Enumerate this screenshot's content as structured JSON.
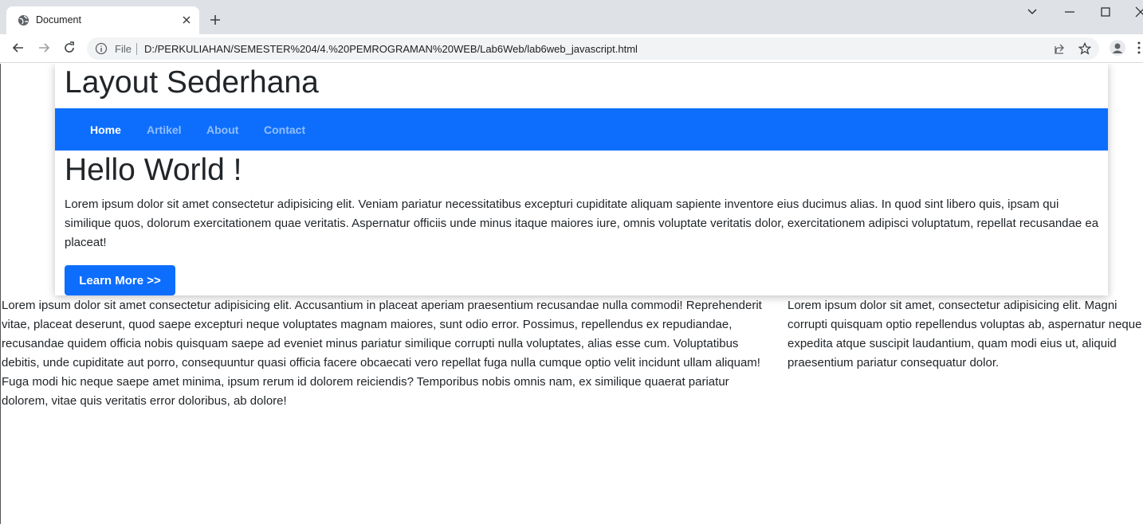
{
  "browser": {
    "tab_title": "Document",
    "file_label": "File",
    "url": "D:/PERKULIAHAN/SEMESTER%204/4.%20PEMROGRAMAN%20WEB/Lab6Web/lab6web_javascript.html",
    "icons": [
      "globe-icon",
      "close-icon",
      "plus-icon",
      "chevron-down-icon",
      "minimize-icon",
      "maximize-icon",
      "back-icon",
      "forward-icon",
      "reload-icon",
      "info-icon",
      "share-icon",
      "star-icon",
      "profile-icon",
      "menu-icon"
    ]
  },
  "page": {
    "site_title": "Layout Sederhana",
    "nav": [
      {
        "label": "Home"
      },
      {
        "label": "Artikel"
      },
      {
        "label": "About"
      },
      {
        "label": "Contact"
      }
    ],
    "hero": {
      "title": "Hello World !",
      "text": "Lorem ipsum dolor sit amet consectetur adipisicing elit. Veniam pariatur necessitatibus excepturi cupiditate aliquam sapiente inventore eius ducimus alias. In quod sint libero quis, ipsam qui similique quos, dolorum exercitationem quae veritatis. Aspernatur officiis unde minus itaque maiores iure, omnis voluptate veritatis dolor, exercitationem adipisci voluptatum, repellat recusandae ea placeat!",
      "button": "Learn More >>"
    },
    "main_article": "Lorem ipsum dolor sit amet consectetur adipisicing elit. Accusantium in placeat aperiam praesentium recusandae nulla commodi! Reprehenderit vitae, placeat deserunt, quod saepe excepturi neque voluptates magnam maiores, sunt odio error. Possimus, repellendus ex repudiandae, recusandae quidem officia nobis quisquam saepe ad eveniet minus pariatur similique corrupti nulla voluptates, alias esse cum. Voluptatibus debitis, unde cupiditate aut porro, consequuntur quasi officia facere obcaecati vero repellat fuga nulla cumque optio velit incidunt ullam aliquam! Fuga modi hic neque saepe amet minima, ipsum rerum id dolorem reiciendis? Temporibus nobis omnis nam, ex similique quaerat pariatur dolorem, vitae quis veritatis error doloribus, ab dolore!",
    "side_article": "Lorem ipsum dolor sit amet, consectetur adipisicing elit. Magni corrupti quisquam optio repellendus voluptas ab, aspernatur neque expedita atque suscipit laudantium, quam modi eius ut, aliquid praesentium pariatur consequatur dolor."
  },
  "colors": {
    "primary": "#0d6efd",
    "nav_inactive": "rgba(255,255,255,0.55)",
    "text": "#212529",
    "tabstrip": "#dee1e6",
    "omnibox": "#f1f3f4"
  }
}
